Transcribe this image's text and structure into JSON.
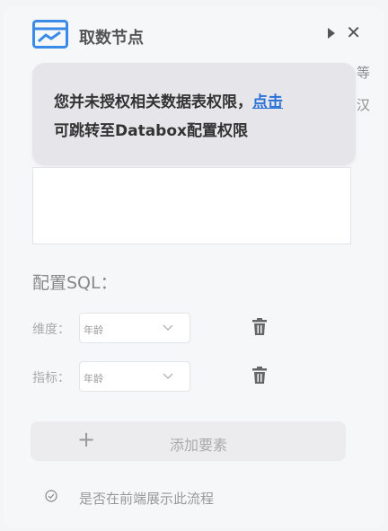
{
  "header": {
    "title": "取数节点",
    "close_label": "✕"
  },
  "background_desc": {
    "left": "—",
    "right_top": "等",
    "right_bottom": "汉"
  },
  "tooltip": {
    "line1_text": "您并未授权相关数据表权限，",
    "link_text": "点击",
    "line2_text": "可跳转至Databox配置权限"
  },
  "config": {
    "section_title": "配置SQL：",
    "rows": [
      {
        "label": "维度：",
        "value": "年龄"
      },
      {
        "label": "指标：",
        "value": "年龄"
      }
    ]
  },
  "add_button": {
    "plus": "+",
    "label": "添加要素"
  },
  "checkbox": {
    "label": "是否在前端展示此流程"
  },
  "colors": {
    "link": "#2a72d8",
    "icon_blue": "#3a8be8"
  }
}
